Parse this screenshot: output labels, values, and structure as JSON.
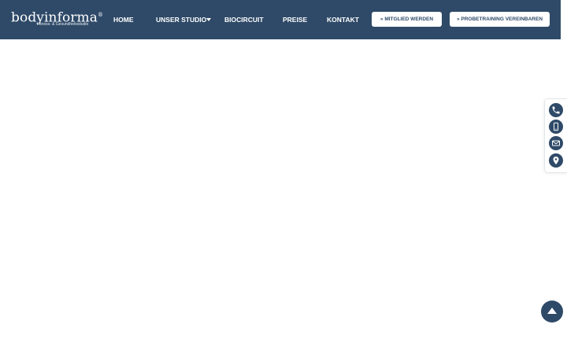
{
  "brand": {
    "name": "bodyinforma",
    "registered_mark": "®",
    "tagline": "Fitness- & Gesundheitsstudio"
  },
  "nav": {
    "home": "HOME",
    "studio": "UNSER STUDIO",
    "biocircuit": "BIOCIRCUIT",
    "preise": "PREISE",
    "kontakt": "KONTAKT"
  },
  "cta": {
    "member": "» MITGLIED WERDEN",
    "trial": "» PROBETRAINING VEREINBAREN"
  },
  "contact_icons": [
    "phone-icon",
    "mobile-icon",
    "mail-icon",
    "location-pin-icon"
  ],
  "colors": {
    "brand": "#2f4a68",
    "background": "#ffffff"
  }
}
